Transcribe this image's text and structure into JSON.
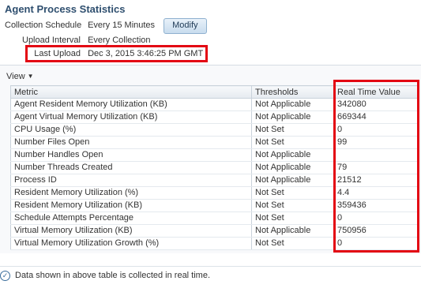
{
  "page": {
    "title": "Agent Process Statistics"
  },
  "info": {
    "collection_schedule": {
      "label": "Collection Schedule",
      "value": "Every 15 Minutes"
    },
    "modify_label": "Modify",
    "upload_interval": {
      "label": "Upload Interval",
      "value": "Every Collection"
    },
    "last_upload": {
      "label": "Last Upload",
      "value": "Dec 3, 2015 3:46:25 PM GMT"
    }
  },
  "toolbar": {
    "view_label": "View",
    "view_caret": "▼"
  },
  "table": {
    "headers": [
      "Metric",
      "Thresholds",
      "Real Time Value"
    ],
    "rows": [
      [
        "Agent Resident Memory Utilization (KB)",
        "Not Applicable",
        "342080"
      ],
      [
        "Agent Virtual Memory Utilization (KB)",
        "Not Applicable",
        "669344"
      ],
      [
        "CPU Usage (%)",
        "Not Set",
        "0"
      ],
      [
        "Number Files Open",
        "Not Set",
        "99"
      ],
      [
        "Number Handles Open",
        "Not Applicable",
        ""
      ],
      [
        "Number Threads Created",
        "Not Applicable",
        "79"
      ],
      [
        "Process ID",
        "Not Applicable",
        "21512"
      ],
      [
        "Resident Memory Utilization (%)",
        "Not Set",
        "4.4"
      ],
      [
        "Resident Memory Utilization (KB)",
        "Not Set",
        "359436"
      ],
      [
        "Schedule Attempts Percentage",
        "Not Set",
        "0"
      ],
      [
        "Virtual Memory Utilization (KB)",
        "Not Applicable",
        "750956"
      ],
      [
        "Virtual Memory Utilization Growth (%)",
        "Not Set",
        "0"
      ]
    ]
  },
  "footer": {
    "note": "Data shown in above table is collected in real time.",
    "icon": "check-circle-icon"
  },
  "colors": {
    "highlight": "#e30613",
    "title": "#2f4f6f"
  }
}
